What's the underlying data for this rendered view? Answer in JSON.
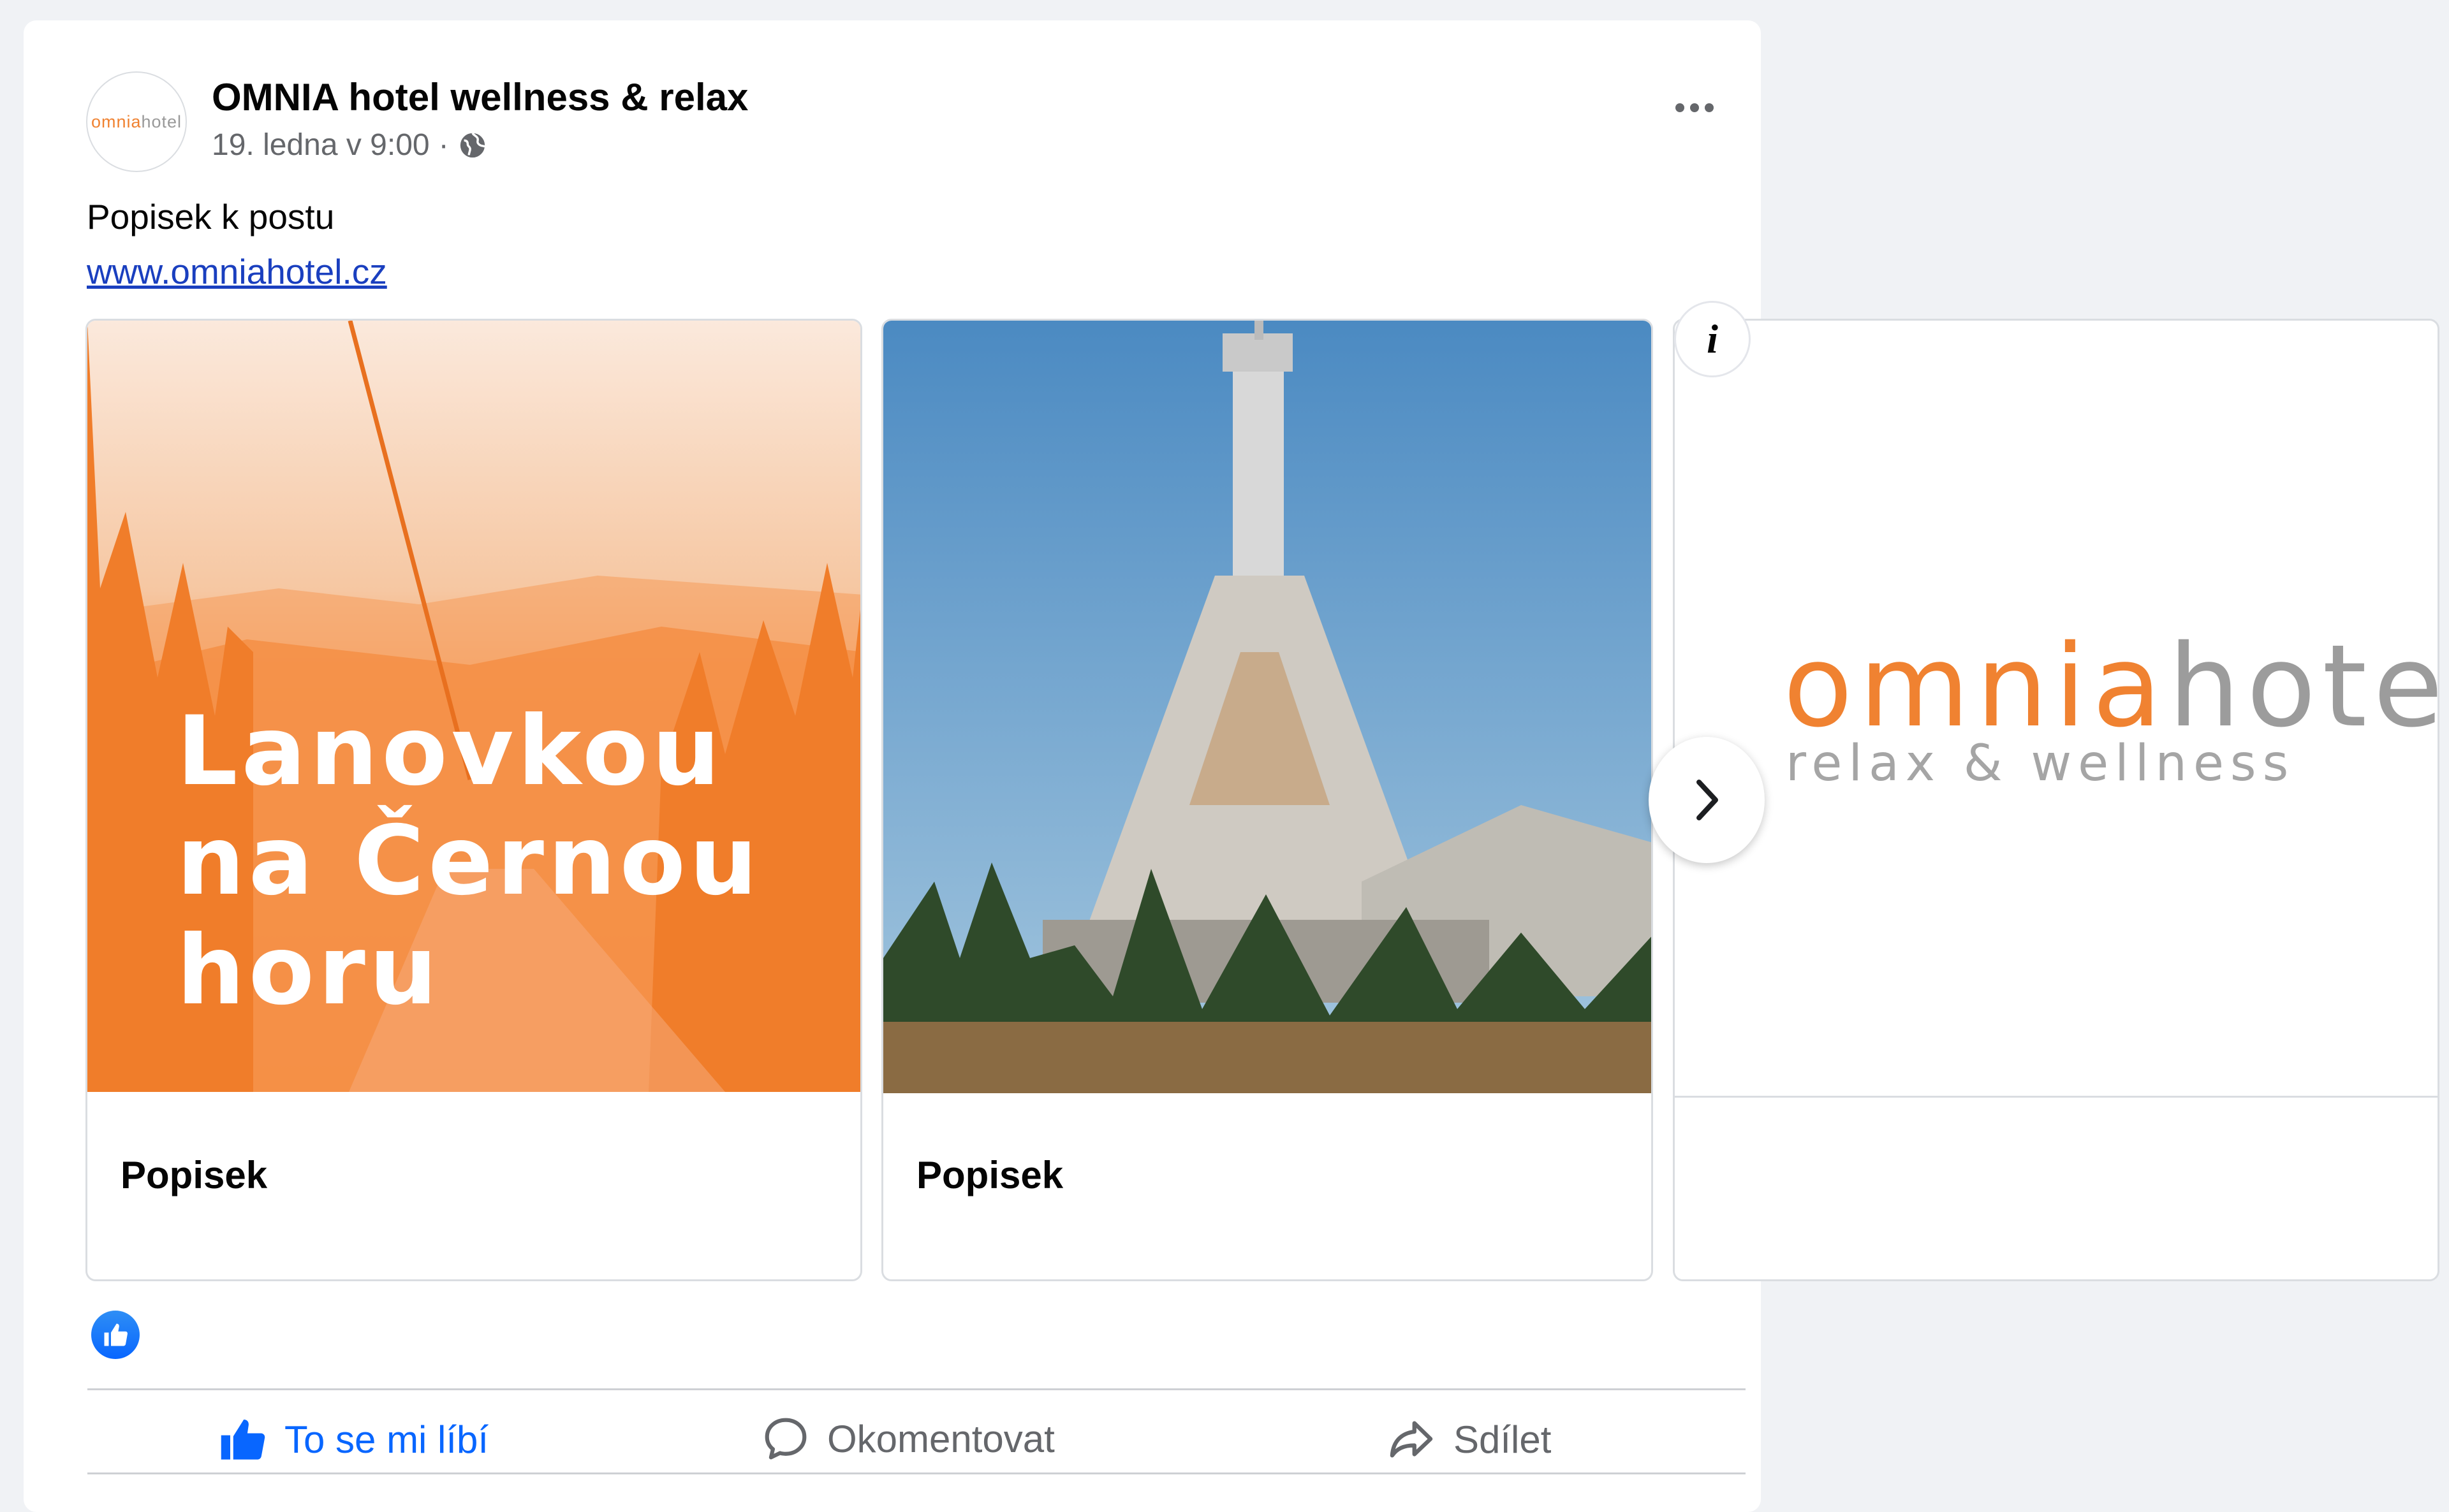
{
  "post": {
    "page_name": "OMNIA hotel wellness & relax",
    "timestamp": "19. ledna v 9:00",
    "separator": "·",
    "caption": "Popisek k postu",
    "link": "www.omniahotel.cz",
    "avatar_logo": {
      "part1": "omnia",
      "part2": "hotel"
    }
  },
  "carousel": {
    "cards": [
      {
        "image_text": [
          "Lanovkou",
          "na Černou",
          "horu"
        ],
        "label": "Popisek"
      },
      {
        "label": "Popisek"
      },
      {
        "brand_part1": "omnia",
        "brand_part2": "hotel",
        "brand_sub": "relax & wellness",
        "label": ""
      }
    ]
  },
  "actions": {
    "like": "To se mi líbí",
    "comment": "Okomentovat",
    "share": "Sdílet"
  },
  "colors": {
    "brand_orange": "#f08231",
    "facebook_blue": "#0866ff",
    "muted_text": "#65676b"
  },
  "icons": [
    "globe-icon",
    "more-options-icon",
    "info-icon",
    "chevron-right-icon",
    "like-reaction-icon",
    "thumbs-up-icon",
    "comment-icon",
    "share-icon"
  ]
}
